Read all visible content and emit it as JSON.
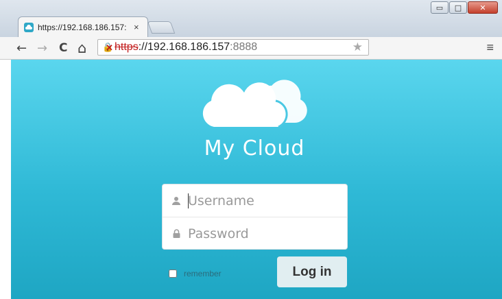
{
  "window": {
    "minimize_glyph": "▭",
    "maximize_glyph": "□",
    "close_glyph": "✕"
  },
  "tab": {
    "title": "https://192.168.186.157:",
    "close_glyph": "×",
    "favicon": "cloud-icon"
  },
  "toolbar": {
    "back_glyph": "←",
    "forward_glyph": "→",
    "reload_glyph": "C",
    "home_glyph": "⌂",
    "url_scheme": "https",
    "url_host": "://192.168.186.157",
    "url_port": ":8888",
    "star_glyph": "★",
    "menu_glyph": "≡"
  },
  "page": {
    "app_title": "My Cloud",
    "username_placeholder": "Username",
    "password_placeholder": "Password",
    "remember_label": "remember",
    "login_label": "Log in"
  },
  "colors": {
    "page_gradient_top": "#5ad6ee",
    "page_gradient_bottom": "#1ea6c3",
    "button_bg": "#e1eef1",
    "insecure_red": "#c21d1d"
  }
}
